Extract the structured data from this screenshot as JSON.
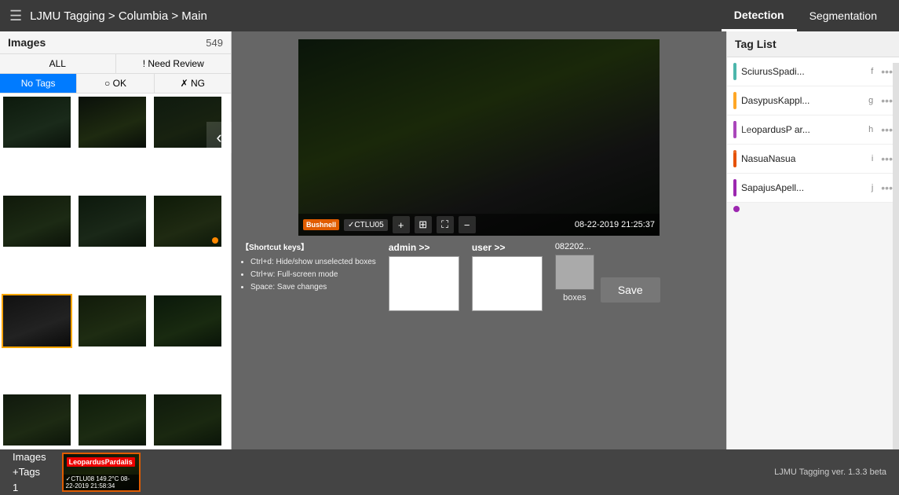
{
  "topNav": {
    "hamburger": "☰",
    "breadcrumb": "LJMU Tagging > Columbia > Main",
    "tabs": [
      {
        "label": "Detection",
        "active": true
      },
      {
        "label": "Segmentation",
        "active": false
      }
    ]
  },
  "leftPanel": {
    "title": "Images",
    "count": "549",
    "filters": {
      "row1": [
        {
          "label": "ALL",
          "active": false
        },
        {
          "label": "! Need Review",
          "active": false
        }
      ],
      "row2": [
        {
          "label": "No Tags",
          "active": true
        },
        {
          "label": "○ OK",
          "active": false
        },
        {
          "label": "✗ NG",
          "active": false
        }
      ]
    },
    "thumbnails": 12
  },
  "mainImage": {
    "bushnellLabel": "Bushnell",
    "ctluLabel": "✓CTLU05",
    "date": "08-22-2019  21:25:37",
    "toolbarIcons": [
      "+",
      "⊞",
      "⛶",
      "−"
    ]
  },
  "shortcutKeys": {
    "title": "【Shortcut keys】",
    "items": [
      "Ctrl+d: Hide/show unselected boxes",
      "Ctrl+w: Full-screen mode",
      "Space: Save changes"
    ]
  },
  "adminSection": {
    "label": "admin >>"
  },
  "userSection": {
    "label": "user >>"
  },
  "boxesSection": {
    "fileName": "082202...",
    "label": "boxes"
  },
  "saveButton": {
    "label": "Save"
  },
  "tagList": {
    "title": "Tag List",
    "items": [
      {
        "name": "SciurusSpadi...",
        "key": "f",
        "color": "#4db6ac"
      },
      {
        "name": "DasypusKappl...",
        "key": "g",
        "color": "#ffa726"
      },
      {
        "name": "LeopardusP ar...",
        "key": "h",
        "color": "#9c27b0"
      },
      {
        "name": "NasuaNasua",
        "key": "i",
        "color": "#e65100"
      },
      {
        "name": "SapajusApell...",
        "key": "j",
        "color": "#9c27b0"
      }
    ]
  },
  "bottomStatus": {
    "imagesLabel": "Images",
    "tagsLabel": "+Tags",
    "countLabel": "1",
    "previewLabel": "LeopardusPardalis",
    "previewFooter": "✓CTLU08  149.2°C  08-22-2019  21:58:34",
    "version": "LJMU Tagging ver. 1.3.3 beta"
  }
}
